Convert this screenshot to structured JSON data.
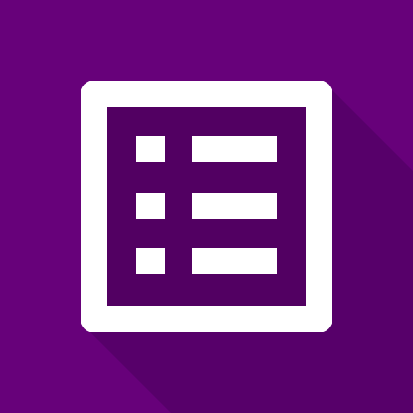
{
  "icon": {
    "name": "list-form-icon",
    "colors": {
      "background": "#67017A",
      "long_shadow": "#57006A",
      "frame": "#FFFFFF",
      "inner_panel": "#520062",
      "glyph": "#FFFFFF"
    },
    "list_rows": 3
  }
}
